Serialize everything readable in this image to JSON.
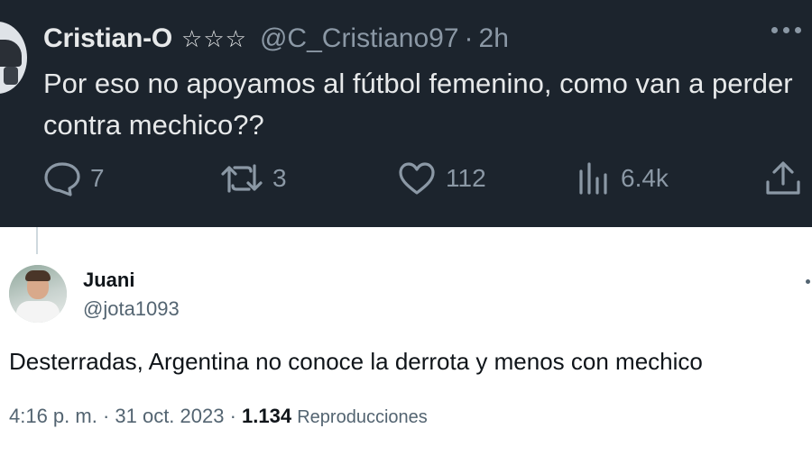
{
  "original_tweet": {
    "display_name": "Cristian-O",
    "badge_stars": "☆☆☆",
    "handle": "@C_Cristiano97",
    "separator": "·",
    "time": "2h",
    "text": "Por eso no apoyamos al fútbol femenino, como van a perder contra mechico??",
    "actions": {
      "replies": "7",
      "retweets": "3",
      "likes": "112",
      "views": "6.4k"
    },
    "theme": {
      "background": "#1c242d",
      "text": "#e7e9ea",
      "muted": "#8b98a5"
    }
  },
  "reply_tweet": {
    "display_name": "Juani",
    "handle": "@jota1093",
    "text": "Desterradas, Argentina no conoce la derrota y menos con mechico",
    "timestamp": "4:16 p. m. · 31 oct. 2023 ·",
    "views_count": "1.134",
    "views_label": "Reproducciones",
    "theme": {
      "background": "#ffffff",
      "text": "#0f1419",
      "muted": "#536471"
    }
  }
}
